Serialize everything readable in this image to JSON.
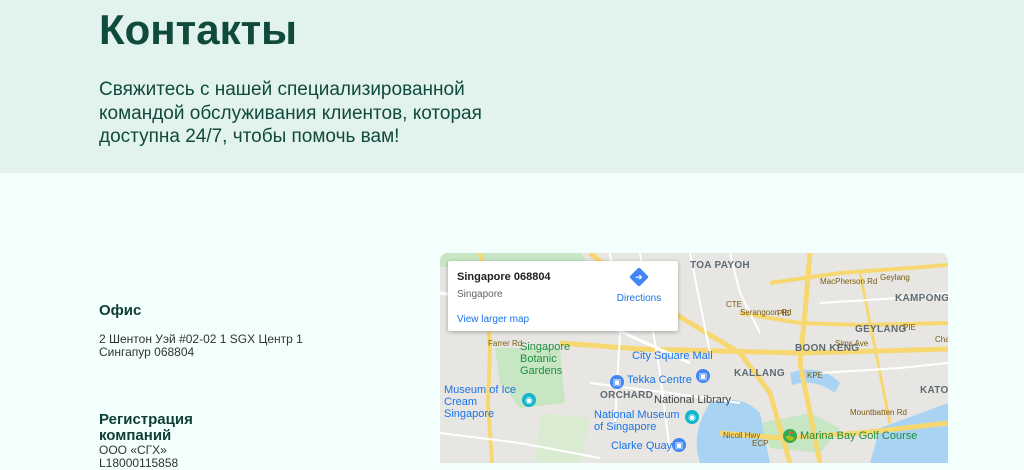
{
  "hero": {
    "title": "Контакты",
    "subtitle": "Свяжитесь с нашей специализированной командой обслуживания клиентов, которая доступна 24/7, чтобы помочь вам!"
  },
  "office": {
    "title": "Офис",
    "address": "2 Шентон Уэй #02-02 1 SGX Центр 1\nСингапур 068804"
  },
  "registration": {
    "title": "Регистрация компаний",
    "text": "ООО «СГХ»\nL18000115858"
  },
  "map": {
    "card": {
      "title": "Singapore 068804",
      "subtitle": "Singapore",
      "link": "View larger map",
      "directions": "Directions"
    },
    "labels": {
      "toa_payoh": "TOA PAYOH",
      "geylang": "GEYLANG",
      "kampong_ubi": "KAMPONG UBI",
      "boon_keng": "BOON KENG",
      "kallang": "KALLANG",
      "orchard": "ORCHARD",
      "botanic": "Singapore Botanic Gardens",
      "city_square": "City Square Mall",
      "tekka": "Tekka Centre",
      "library": "National Library",
      "museum_ice": "Museum of Ice Cream Singapore",
      "national_museum": "National Museum of Singapore",
      "clarke_quay": "Clarke Quay",
      "marina_golf": "Marina Bay Golf Course",
      "pie": "PIE",
      "cte": "CTE",
      "kpe": "KPE",
      "ecp": "ECP",
      "macpherson": "MacPherson Rd",
      "sims": "Sims Ave",
      "serangoon": "Serangoon Rd",
      "farrer": "Farrer Rd",
      "mountbatten": "Mountbatten Rd",
      "nicoll": "Nicoll Hwy",
      "katong": "KATON",
      "changi": "Changi",
      "pie2": "PIE",
      "geylang2": "Geylang"
    },
    "colors": {
      "land": "#e8e6e2",
      "park": "#c7e6c4",
      "water": "#a9d3f2",
      "highway": "#f7d770",
      "road": "#ffffff"
    }
  }
}
